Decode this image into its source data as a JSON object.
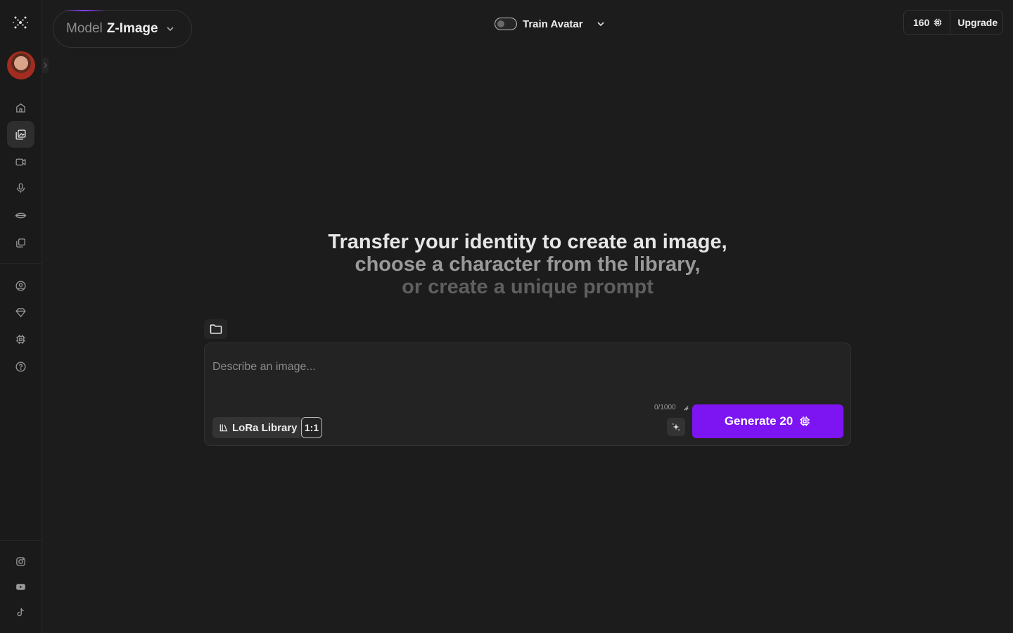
{
  "sidebar": {
    "logo_icon": "sparkle-logo-icon",
    "nav_top": [
      {
        "icon": "home-icon",
        "active": false
      },
      {
        "icon": "image-gallery-icon",
        "active": true
      },
      {
        "icon": "video-camera-icon",
        "active": false
      },
      {
        "icon": "microphone-icon",
        "active": false
      },
      {
        "icon": "lips-icon",
        "active": false
      },
      {
        "icon": "copy-stack-icon",
        "active": false
      }
    ],
    "nav_middle": [
      {
        "icon": "user-circle-icon"
      },
      {
        "icon": "diamond-icon"
      },
      {
        "icon": "chip-settings-icon"
      },
      {
        "icon": "help-circle-icon"
      }
    ],
    "nav_social": [
      {
        "icon": "instagram-icon"
      },
      {
        "icon": "youtube-icon"
      },
      {
        "icon": "tiktok-icon"
      }
    ]
  },
  "header": {
    "model_label": "Model",
    "model_value": "Z-Image",
    "train_avatar_label": "Train Avatar",
    "credits": "160",
    "upgrade_label": "Upgrade"
  },
  "hero": {
    "line1": "Transfer your identity to create an image,",
    "line2": "choose a character from the library,",
    "line3": "or create a unique prompt"
  },
  "prompt": {
    "placeholder": "Describe an image...",
    "value": "",
    "lora_label": "LoRa Library",
    "ratio_label": "1:1",
    "char_count": "0/1000",
    "generate_label": "Generate 20"
  },
  "colors": {
    "accent": "#7d14f2",
    "background": "#1c1c1c"
  }
}
